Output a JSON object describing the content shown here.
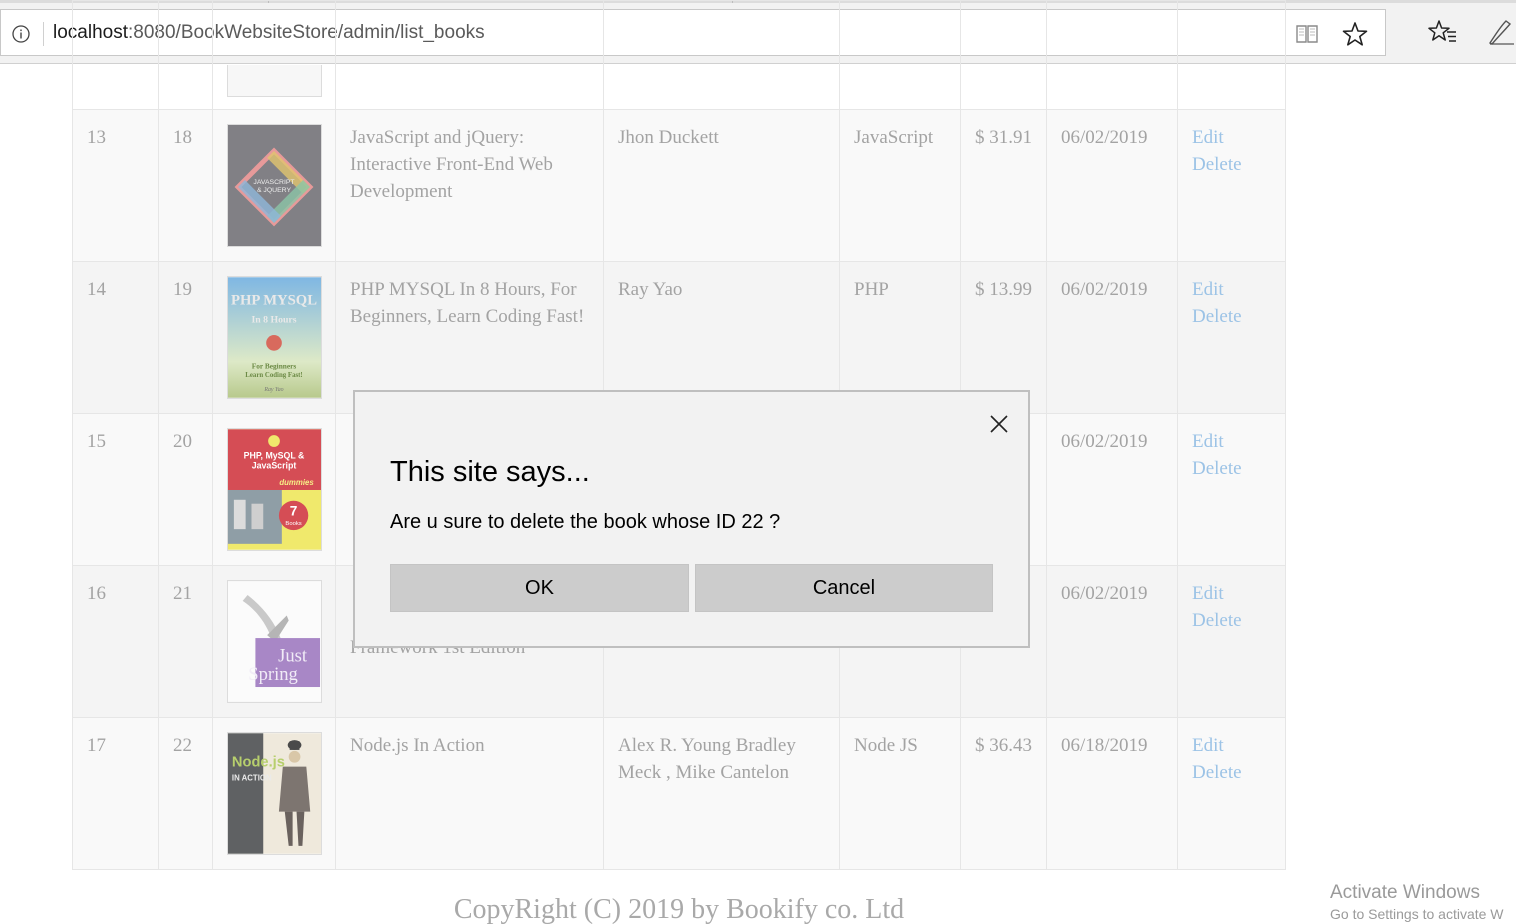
{
  "browser": {
    "url_host": "localhost",
    "url_path": ":8080/BookWebsiteStore/admin/list_books",
    "icons": [
      "info-icon",
      "reading-view-icon",
      "favorite-star-icon",
      "favorites-list-icon",
      "pen-notes-icon"
    ]
  },
  "table": {
    "rows": [
      {
        "index": "13",
        "id": "18",
        "cover": "javascript-jquery-cover",
        "title": "JavaScript and jQuery: Interactive Front-End Web Development",
        "author": "Jhon Duckett",
        "category": "JavaScript",
        "price": "$ 31.91",
        "date": "06/02/2019",
        "edit": "Edit",
        "delete": "Delete"
      },
      {
        "index": "14",
        "id": "19",
        "cover": "php-mysql-cover",
        "title": "PHP MYSQL In 8 Hours, For Beginners, Learn Coding Fast!",
        "author": "Ray Yao",
        "category": "PHP",
        "price": "$ 13.99",
        "date": "06/02/2019",
        "edit": "Edit",
        "delete": "Delete"
      },
      {
        "index": "15",
        "id": "20",
        "cover": "php-mysql-js-dummies-cover",
        "title": "",
        "author": "",
        "category": "",
        "price": "",
        "date": "06/02/2019",
        "edit": "Edit",
        "delete": "Delete"
      },
      {
        "index": "16",
        "id": "21",
        "cover": "just-spring-cover",
        "title": "Framework 1st Edition",
        "author": "",
        "category": "",
        "price": "",
        "date": "06/02/2019",
        "edit": "Edit",
        "delete": "Delete"
      },
      {
        "index": "17",
        "id": "22",
        "cover": "nodejs-in-action-cover",
        "title": "Node.js In Action",
        "author": "Alex R. Young Bradley Meck , Mike Cantelon",
        "category": "Node JS",
        "price": "$ 36.43",
        "date": "06/18/2019",
        "edit": "Edit",
        "delete": "Delete"
      }
    ]
  },
  "covers": {
    "jq_line1": "JAVASCRIPT",
    "jq_line2": "& JQUERY",
    "php_line1": "PHP MYSQL",
    "php_line2": "In 8 Hours",
    "php_line3": "For Beginners",
    "php_line4": "Learn Coding Fast!",
    "php_author": "Ray Yao",
    "dummies_line1": "PHP, MySQL &",
    "dummies_line2": "JavaScript",
    "dummies_brand": "dummies",
    "dummies_num": "7",
    "dummies_books": "Books",
    "spring_line1": "Just",
    "spring_line2": "Spring",
    "node_line1": "Node.js",
    "node_line2": "IN ACTION"
  },
  "footer": {
    "copyright": "CopyRight (C) 2019 by Bookify co. Ltd"
  },
  "watermark": {
    "line1": "Activate Windows",
    "line2": "Go to Settings to activate W"
  },
  "dialog": {
    "title": "This site says...",
    "message": "Are u sure to delete the book whose ID 22 ?",
    "ok_label": "OK",
    "cancel_label": "Cancel"
  }
}
